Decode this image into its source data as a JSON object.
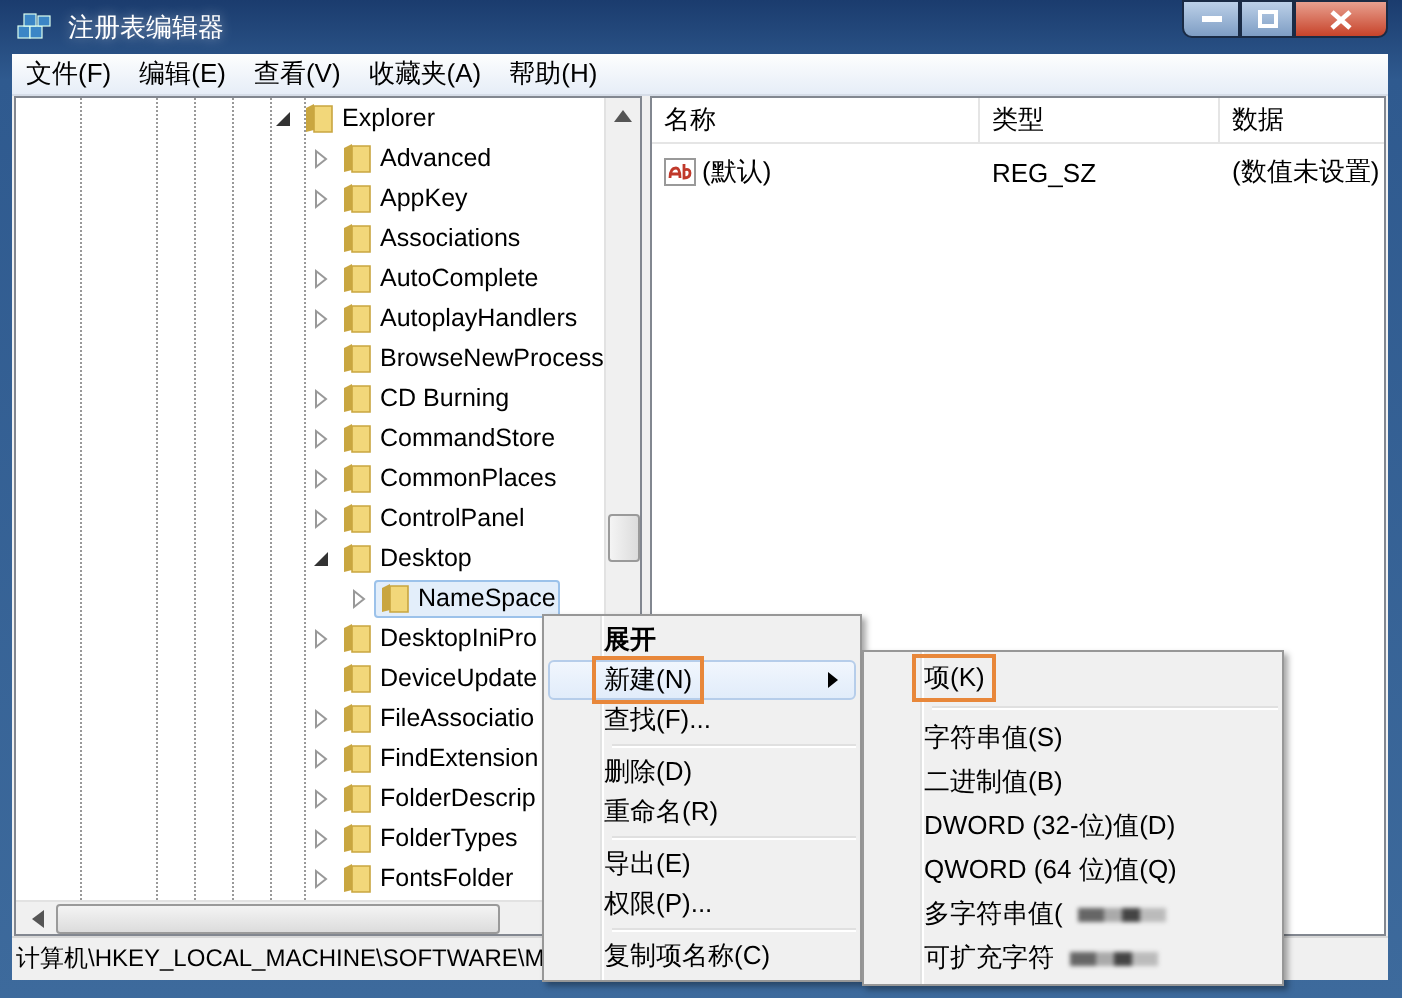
{
  "window": {
    "title": "注册表编辑器"
  },
  "menu": [
    "文件(F)",
    "编辑(E)",
    "查看(V)",
    "收藏夹(A)",
    "帮助(H)"
  ],
  "tree": {
    "items": [
      {
        "label": "Explorer",
        "expandable": true,
        "expanded": true,
        "selected": false,
        "children": [
          {
            "label": "Advanced",
            "expandable": true,
            "expanded": false,
            "selected": false
          },
          {
            "label": "AppKey",
            "expandable": true,
            "expanded": false,
            "selected": false
          },
          {
            "label": "Associations",
            "expandable": false,
            "expanded": false,
            "selected": false
          },
          {
            "label": "AutoComplete",
            "expandable": true,
            "expanded": false,
            "selected": false
          },
          {
            "label": "AutoplayHandlers",
            "expandable": true,
            "expanded": false,
            "selected": false
          },
          {
            "label": "BrowseNewProcess",
            "expandable": false,
            "expanded": false,
            "selected": false
          },
          {
            "label": "CD Burning",
            "expandable": true,
            "expanded": false,
            "selected": false
          },
          {
            "label": "CommandStore",
            "expandable": true,
            "expanded": false,
            "selected": false
          },
          {
            "label": "CommonPlaces",
            "expandable": true,
            "expanded": false,
            "selected": false
          },
          {
            "label": "ControlPanel",
            "expandable": true,
            "expanded": false,
            "selected": false
          },
          {
            "label": "Desktop",
            "expandable": true,
            "expanded": true,
            "selected": false,
            "children": [
              {
                "label": "NameSpace",
                "expandable": true,
                "expanded": false,
                "selected": true
              }
            ]
          },
          {
            "label": "DesktopIniPro",
            "expandable": true,
            "expanded": false,
            "selected": false
          },
          {
            "label": "DeviceUpdate",
            "expandable": false,
            "expanded": false,
            "selected": false
          },
          {
            "label": "FileAssociatio",
            "expandable": true,
            "expanded": false,
            "selected": false
          },
          {
            "label": "FindExtension",
            "expandable": true,
            "expanded": false,
            "selected": false
          },
          {
            "label": "FolderDescrip",
            "expandable": true,
            "expanded": false,
            "selected": false
          },
          {
            "label": "FolderTypes",
            "expandable": true,
            "expanded": false,
            "selected": false
          },
          {
            "label": "FontsFolder",
            "expandable": true,
            "expanded": false,
            "selected": false
          }
        ]
      }
    ]
  },
  "list": {
    "columns": [
      "名称",
      "类型",
      "数据"
    ],
    "rows": [
      {
        "cells": [
          "(默认)",
          "REG_SZ",
          "(数值未设置)"
        ]
      }
    ]
  },
  "status_bar": "计算机\\HKEY_LOCAL_MACHINE\\SOFTWARE\\M",
  "context_menu": {
    "items": [
      {
        "kind": "item",
        "label": "展开",
        "bold": true,
        "selected": false,
        "highlighted": false,
        "submenu": false
      },
      {
        "kind": "item",
        "label": "新建(N)",
        "bold": false,
        "selected": true,
        "highlighted": true,
        "submenu": true
      },
      {
        "kind": "item",
        "label": "查找(F)...",
        "bold": false,
        "selected": false,
        "highlighted": false,
        "submenu": false
      },
      {
        "kind": "separator"
      },
      {
        "kind": "item",
        "label": "删除(D)",
        "bold": false,
        "selected": false,
        "highlighted": false,
        "submenu": false
      },
      {
        "kind": "item",
        "label": "重命名(R)",
        "bold": false,
        "selected": false,
        "highlighted": false,
        "submenu": false
      },
      {
        "kind": "separator"
      },
      {
        "kind": "item",
        "label": "导出(E)",
        "bold": false,
        "selected": false,
        "highlighted": false,
        "submenu": false
      },
      {
        "kind": "item",
        "label": "权限(P)...",
        "bold": false,
        "selected": false,
        "highlighted": false,
        "submenu": false
      },
      {
        "kind": "separator"
      },
      {
        "kind": "item",
        "label": "复制项名称(C)",
        "bold": false,
        "selected": false,
        "highlighted": false,
        "submenu": false
      }
    ]
  },
  "submenu": {
    "items": [
      {
        "kind": "item",
        "label": "项(K)",
        "highlighted": true,
        "redacted": false
      },
      {
        "kind": "separator"
      },
      {
        "kind": "item",
        "label": "字符串值(S)",
        "highlighted": false,
        "redacted": false
      },
      {
        "kind": "item",
        "label": "二进制值(B)",
        "highlighted": false,
        "redacted": false
      },
      {
        "kind": "item",
        "label": "DWORD (32-位)值(D)",
        "highlighted": false,
        "redacted": false
      },
      {
        "kind": "item",
        "label": "QWORD (64 位)值(Q)",
        "highlighted": false,
        "redacted": false
      },
      {
        "kind": "item",
        "label": "多字符串值(",
        "highlighted": false,
        "redacted": true
      },
      {
        "kind": "item",
        "label": "可扩充字符",
        "highlighted": false,
        "redacted": true
      }
    ]
  }
}
